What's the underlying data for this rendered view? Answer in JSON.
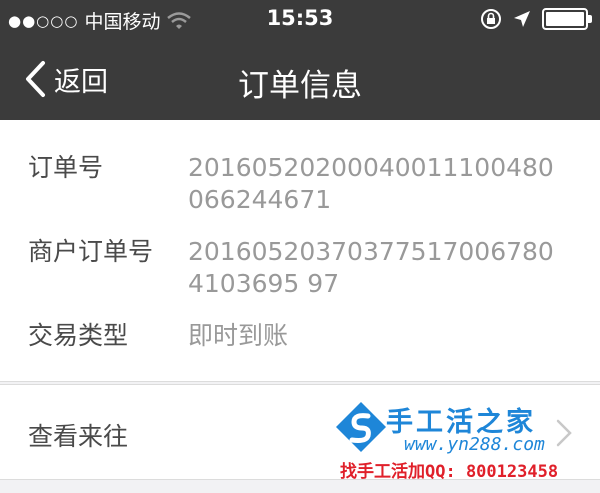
{
  "status_bar": {
    "signal": "●●○○○",
    "carrier": "中国移动",
    "time": "15:53"
  },
  "nav": {
    "back_label": "返回",
    "title": "订单信息"
  },
  "order": {
    "rows": [
      {
        "label": "订单号",
        "value": "20160520200040011100480066244671"
      },
      {
        "label": "商户订单号",
        "value": "201605203703775170067804103695 97"
      },
      {
        "label": "交易类型",
        "value": "即时到账"
      }
    ]
  },
  "history": {
    "label": "查看来往"
  },
  "watermark": {
    "title": "手工活之家",
    "url": "www.yn288.com",
    "contact": "找手工活加QQ: 800123458"
  },
  "colors": {
    "bar": "#3b3b3b",
    "watermark_blue": "#1e86d8",
    "watermark_red": "#e0202a"
  }
}
